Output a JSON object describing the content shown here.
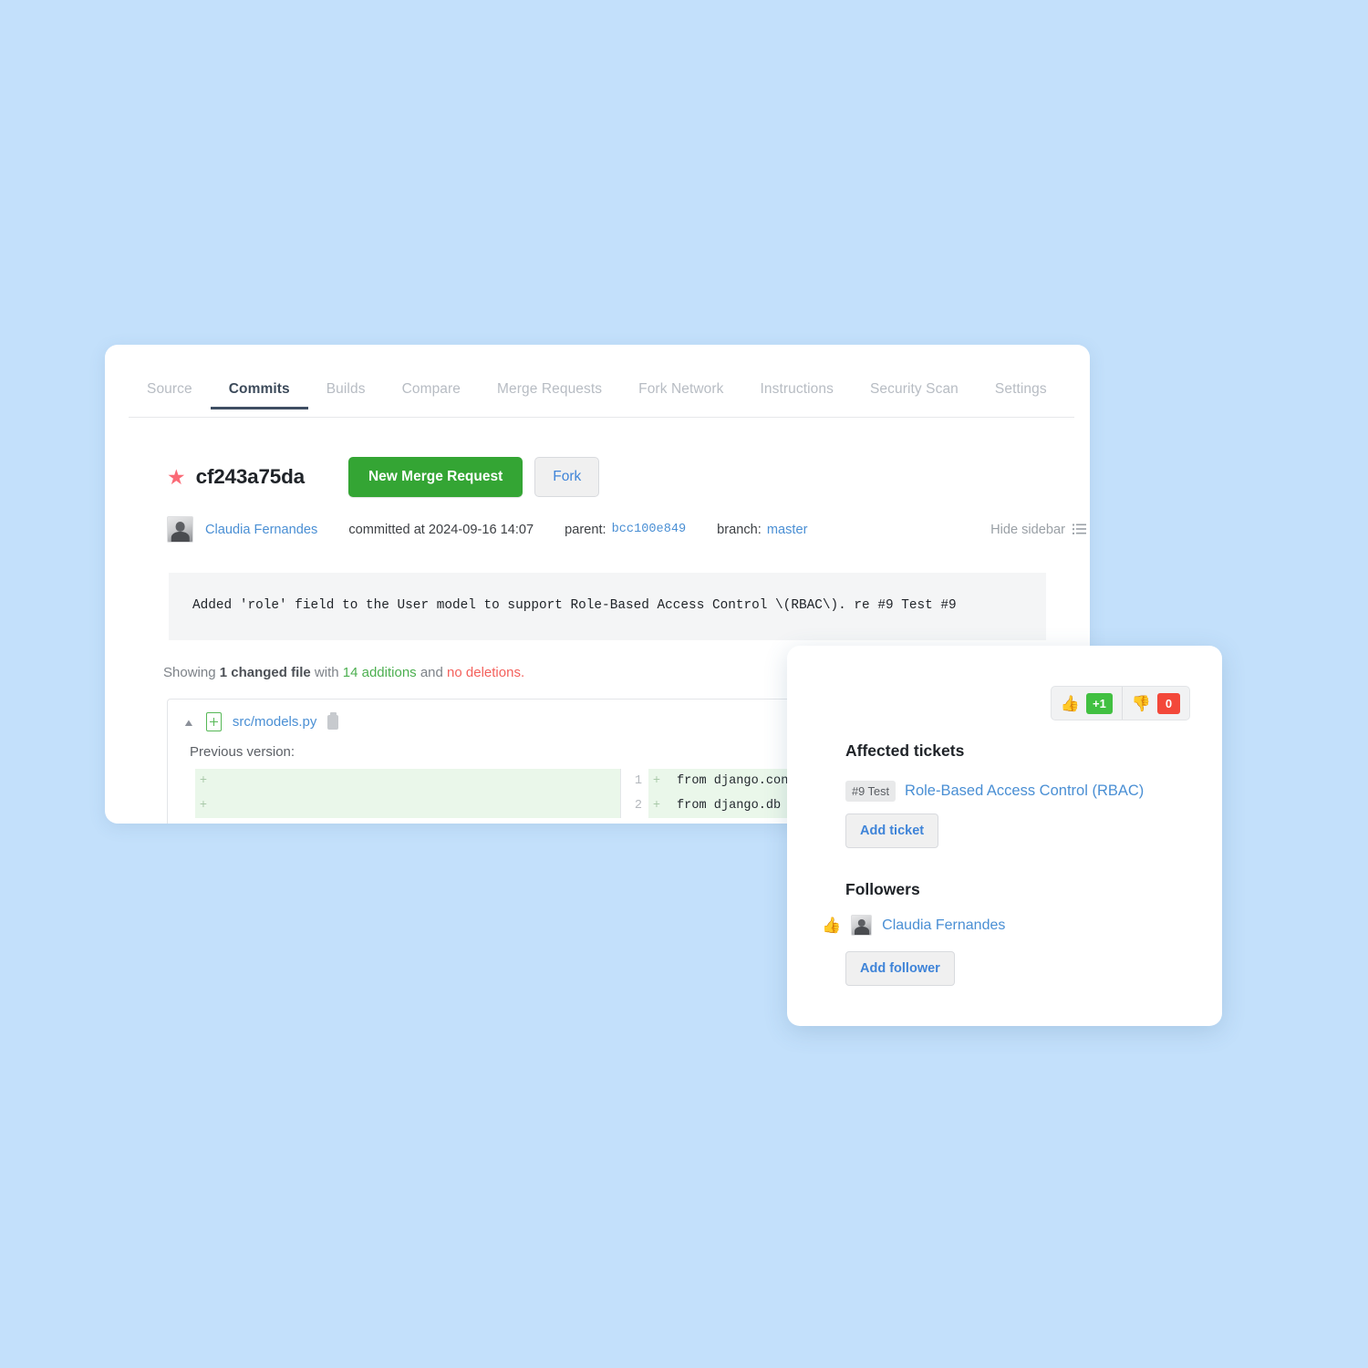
{
  "background_color": "#c3e0fb",
  "tabs": [
    {
      "label": "Source",
      "active": false
    },
    {
      "label": "Commits",
      "active": true
    },
    {
      "label": "Builds",
      "active": false
    },
    {
      "label": "Compare",
      "active": false
    },
    {
      "label": "Merge Requests",
      "active": false
    },
    {
      "label": "Fork Network",
      "active": false
    },
    {
      "label": "Instructions",
      "active": false
    },
    {
      "label": "Security Scan",
      "active": false
    },
    {
      "label": "Settings",
      "active": false
    }
  ],
  "commit": {
    "star_icon": "star-icon",
    "sha": "cf243a75da",
    "new_merge_request_label": "New Merge Request",
    "fork_label": "Fork",
    "author": "Claudia Fernandes",
    "committed_label": "committed at 2024-09-16 14:07",
    "parent_label": "parent:",
    "parent_sha": "bcc100e849",
    "branch_label": "branch:",
    "branch_name": "master",
    "hide_sidebar_label": "Hide sidebar",
    "hide_sidebar_icon": "list-icon",
    "message": "Added 'role' field to the User model to support Role-Based Access Control \\(RBAC\\). re #9 Test #9"
  },
  "diff_summary": {
    "prefix": "Showing ",
    "changed_files": "1 changed file",
    "middle": " with ",
    "additions": "14 additions",
    "conjunction": " and ",
    "deletions": "no deletions",
    "suffix": "."
  },
  "file_diff": {
    "collapse_icon": "chevron-up-icon",
    "status_icon": "file-added-icon",
    "file_name": "src/models.py",
    "copy_icon": "clipboard-icon",
    "previous_version_label": "Previous version:",
    "lines": [
      {
        "old_num": "",
        "old_text": "",
        "new_num": "1",
        "sign": "+",
        "new_text": "from django.contrib.a"
      },
      {
        "old_num": "",
        "old_text": "",
        "new_num": "2",
        "sign": "+",
        "new_text": "from django.db import"
      }
    ]
  },
  "sidebar": {
    "vote": {
      "up_icon": "thumbs-up-icon",
      "up_count": "+1",
      "down_icon": "thumbs-down-icon",
      "down_count": "0"
    },
    "affected_tickets_heading": "Affected tickets",
    "tickets": [
      {
        "badge": "#9 Test",
        "title": "Role-Based Access Control (RBAC)"
      }
    ],
    "add_ticket_label": "Add ticket",
    "followers_heading": "Followers",
    "followers": [
      {
        "vote_icon": "thumbs-up-icon",
        "name": "Claudia Fernandes"
      }
    ],
    "add_follower_label": "Add follower"
  },
  "colors": {
    "merge_green": "#34a534",
    "link_blue": "#4a8fd4",
    "star_pink": "#fa6a76",
    "badge_green": "#41c041",
    "badge_red": "#f3483a",
    "addition_green": "#4caf50",
    "deletion_red": "#f4615c"
  }
}
